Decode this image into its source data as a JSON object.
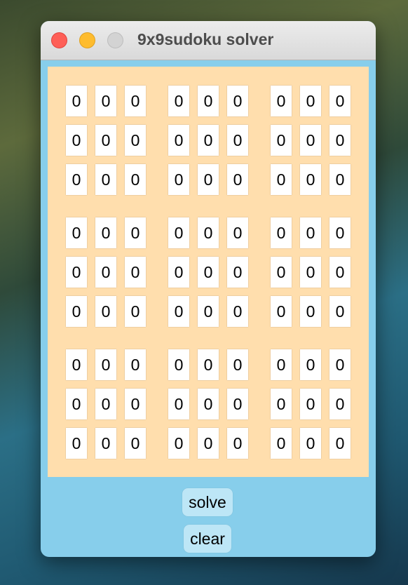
{
  "window": {
    "title": "9x9sudoku solver"
  },
  "grid": [
    [
      "0",
      "0",
      "0",
      "0",
      "0",
      "0",
      "0",
      "0",
      "0"
    ],
    [
      "0",
      "0",
      "0",
      "0",
      "0",
      "0",
      "0",
      "0",
      "0"
    ],
    [
      "0",
      "0",
      "0",
      "0",
      "0",
      "0",
      "0",
      "0",
      "0"
    ],
    [
      "0",
      "0",
      "0",
      "0",
      "0",
      "0",
      "0",
      "0",
      "0"
    ],
    [
      "0",
      "0",
      "0",
      "0",
      "0",
      "0",
      "0",
      "0",
      "0"
    ],
    [
      "0",
      "0",
      "0",
      "0",
      "0",
      "0",
      "0",
      "0",
      "0"
    ],
    [
      "0",
      "0",
      "0",
      "0",
      "0",
      "0",
      "0",
      "0",
      "0"
    ],
    [
      "0",
      "0",
      "0",
      "0",
      "0",
      "0",
      "0",
      "0",
      "0"
    ],
    [
      "0",
      "0",
      "0",
      "0",
      "0",
      "0",
      "0",
      "0",
      "0"
    ]
  ],
  "buttons": {
    "solve": "solve",
    "clear": "clear"
  }
}
